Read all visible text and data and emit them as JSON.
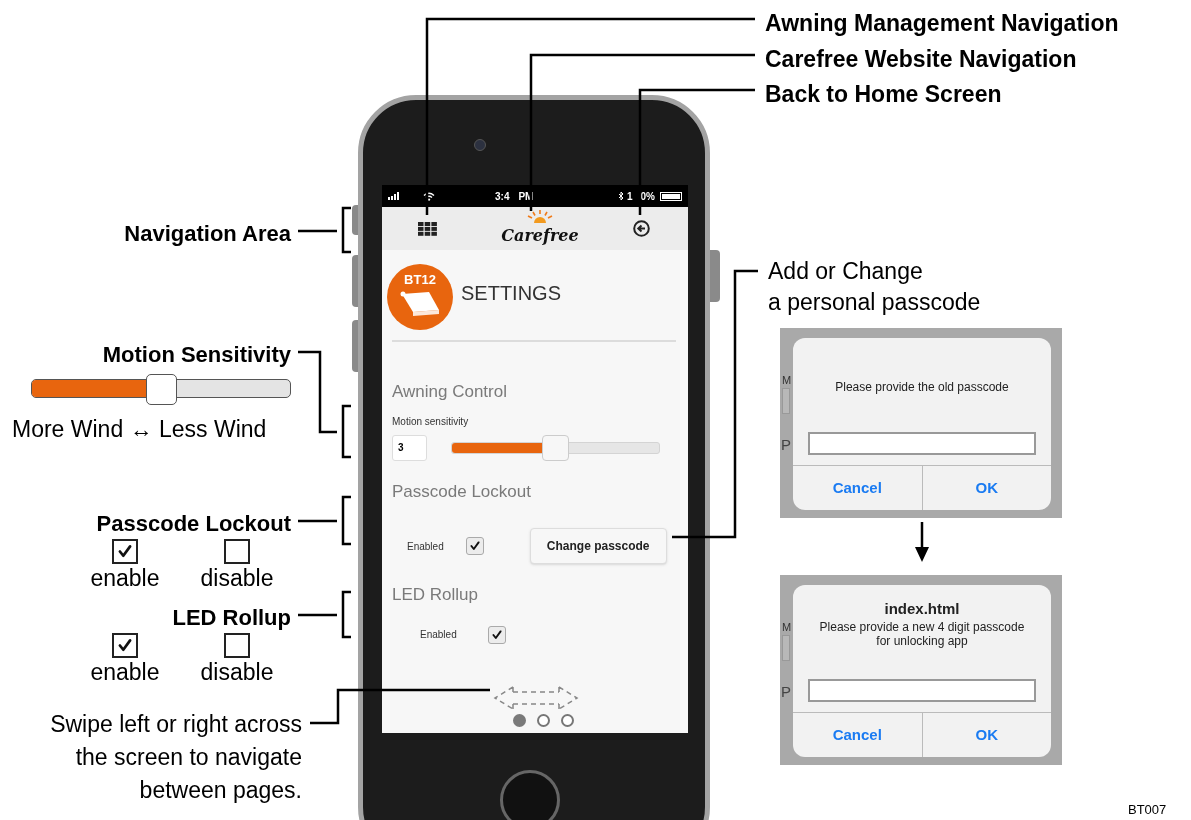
{
  "phone": {
    "status_bar": {
      "time_parts": [
        "3:4",
        "PM"
      ],
      "battery_parts": [
        "1",
        "0%"
      ]
    },
    "nav_bar": {
      "logo": "Carefree"
    },
    "header": {
      "badge": "BT12",
      "title": "SETTINGS"
    },
    "sections": [
      {
        "kind": "slider",
        "title": "Awning Control",
        "label": "Motion sensitivity",
        "value": "3",
        "level": 0.5
      },
      {
        "kind": "checkbox_button",
        "title": "Passcode Lockout",
        "label": "Enabled",
        "checked": true,
        "button": "Change passcode"
      },
      {
        "kind": "checkbox",
        "title": "LED Rollup",
        "label": "Enabled",
        "checked": true
      }
    ],
    "page_dots": [
      {
        "selected": true
      },
      {
        "selected": false
      },
      {
        "selected": false
      }
    ]
  },
  "annotations": {
    "top": [
      "Awning Management Navigation",
      "Carefree Website Navigation",
      "Back to Home Screen"
    ],
    "navigation_area": "Navigation Area",
    "motion": {
      "title": "Motion Sensitivity",
      "level": 0.5,
      "caption": "More Wind ↔ Less Wind"
    },
    "toggles": [
      {
        "title": "Passcode Lockout",
        "options": [
          {
            "label": "enable",
            "checked": true
          },
          {
            "label": "disable",
            "checked": false
          }
        ]
      },
      {
        "title": "LED Rollup",
        "options": [
          {
            "label": "enable",
            "checked": true
          },
          {
            "label": "disable",
            "checked": false
          }
        ]
      }
    ],
    "swipe": [
      "Swipe left or right across",
      "the screen to navigate",
      "between pages."
    ],
    "passcode": [
      "Add or Change",
      "a personal passcode"
    ]
  },
  "dialogs": [
    {
      "backdrop": [
        "M",
        "P"
      ],
      "message": "Please provide the old passcode",
      "buttons": [
        "Cancel",
        "OK"
      ]
    },
    {
      "title": "index.html",
      "backdrop": [
        "M",
        "P"
      ],
      "message": "Please provide a new 4 digit passcode for unlocking app",
      "buttons": [
        "Cancel",
        "OK"
      ]
    }
  ],
  "figure_id": "BT007"
}
